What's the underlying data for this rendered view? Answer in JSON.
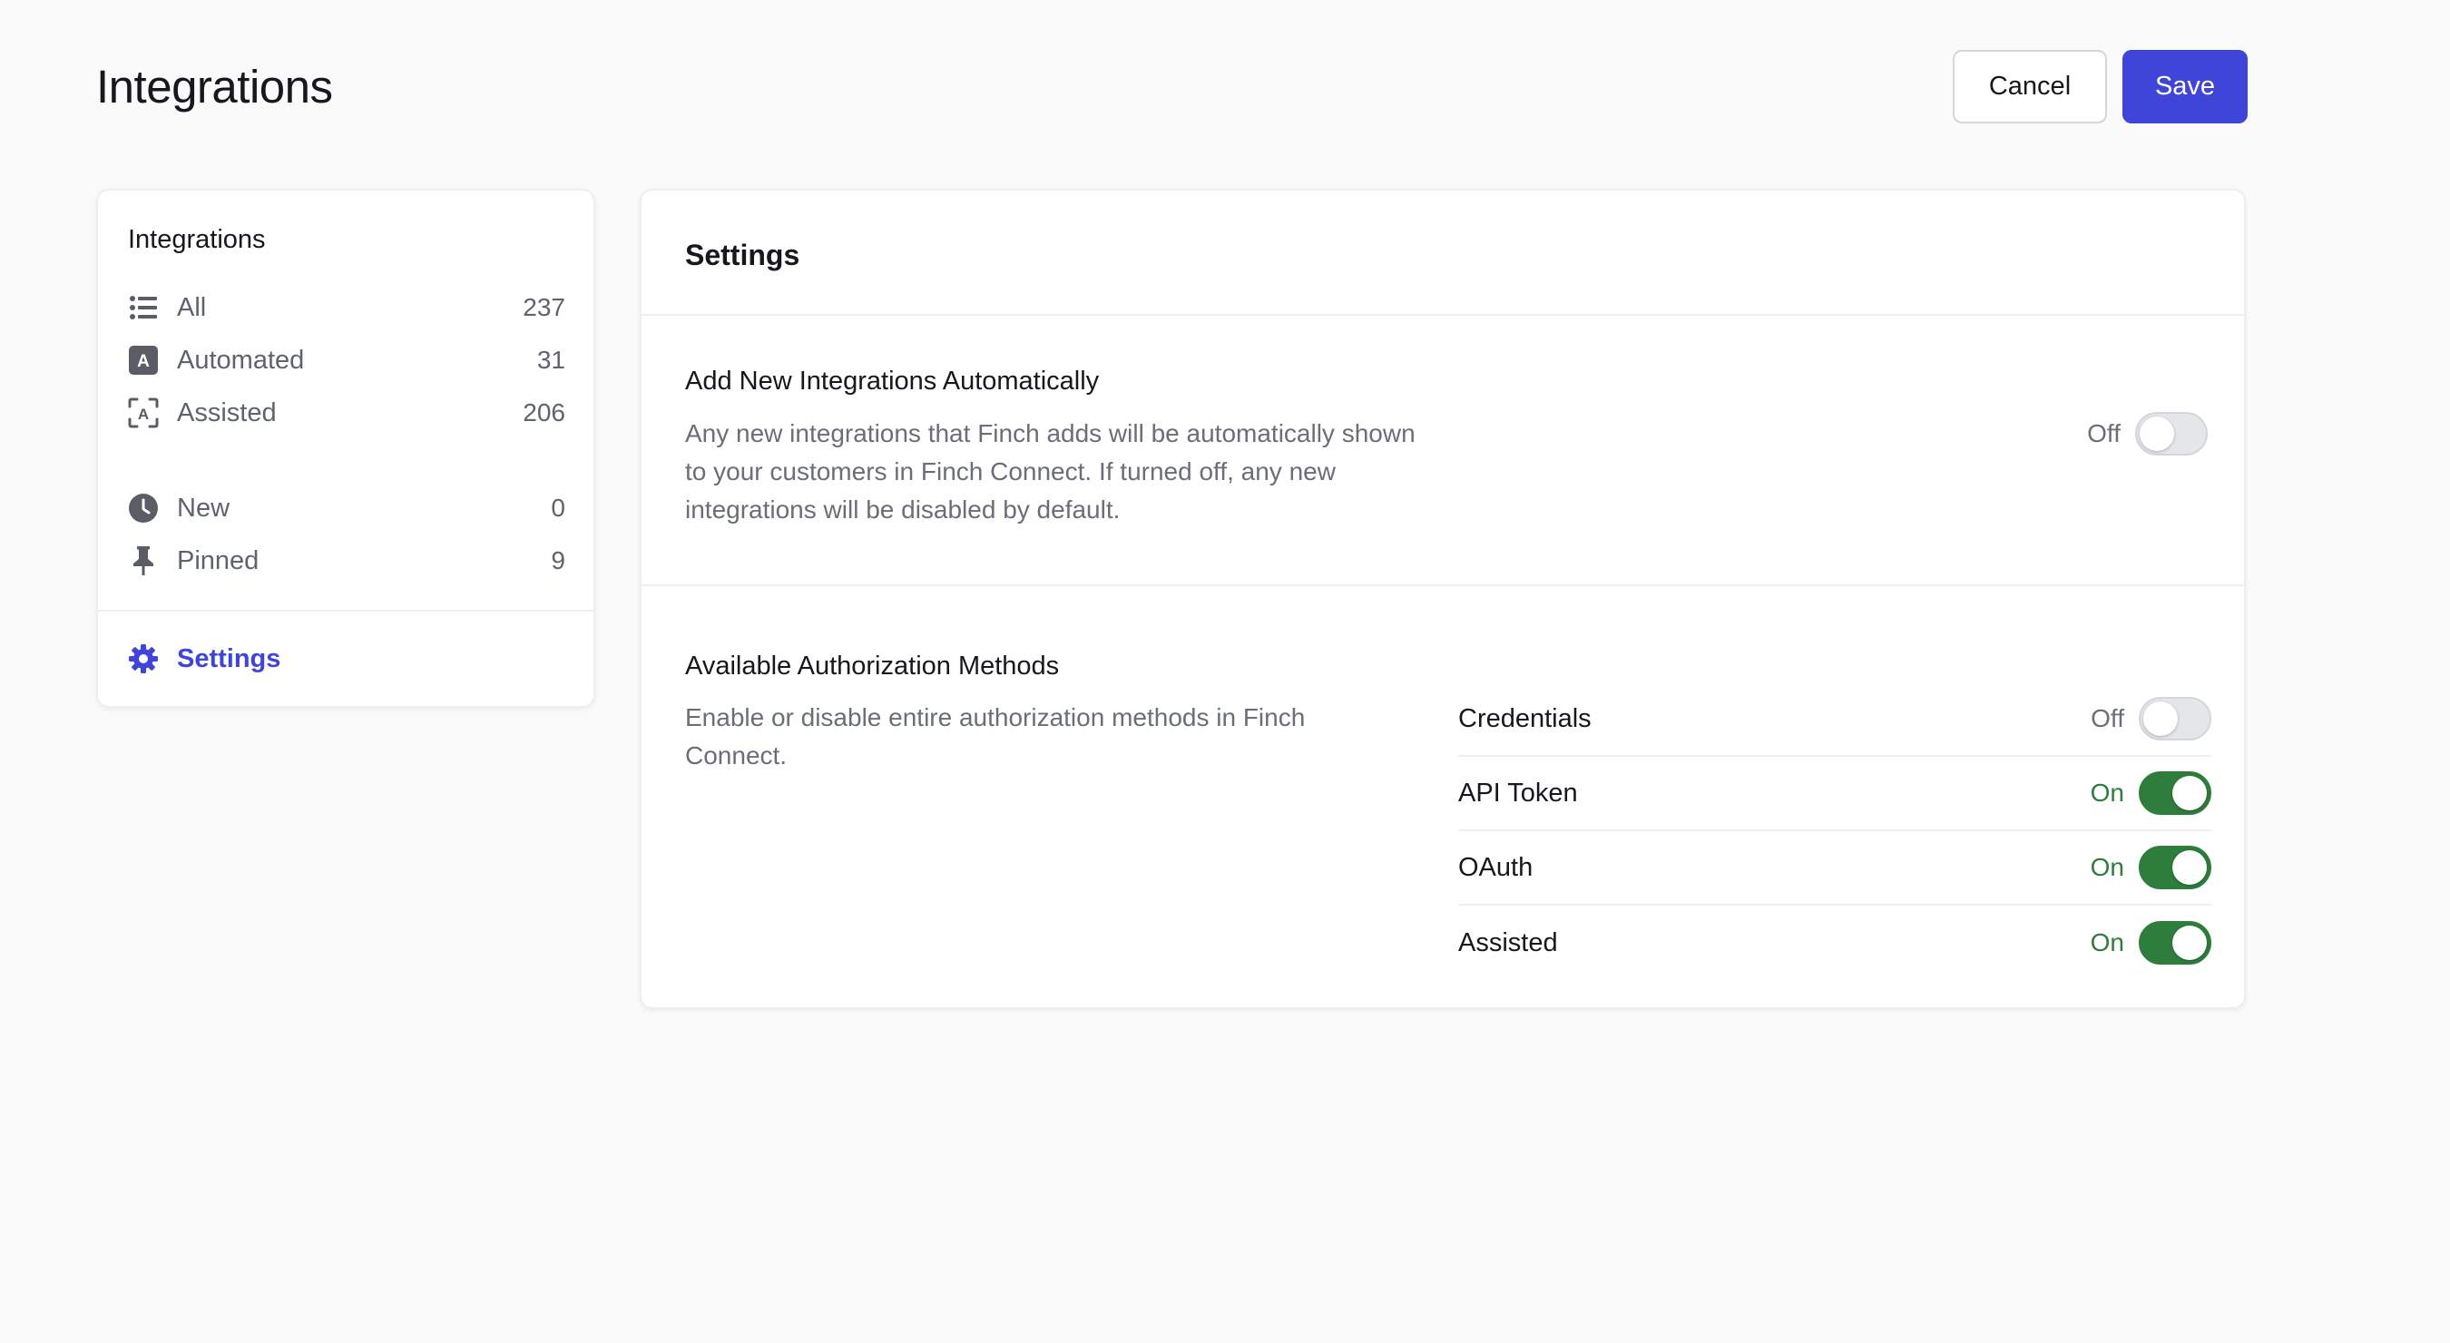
{
  "header": {
    "title": "Integrations",
    "cancel_label": "Cancel",
    "save_label": "Save",
    "accent_color": "#3e45d8"
  },
  "sidebar": {
    "heading": "Integrations",
    "items": [
      {
        "label": "All",
        "count": "237",
        "icon": "list-icon"
      },
      {
        "label": "Automated",
        "count": "31",
        "icon": "automated-icon"
      },
      {
        "label": "Assisted",
        "count": "206",
        "icon": "assisted-icon"
      },
      {
        "label": "New",
        "count": "0",
        "icon": "clock-icon"
      },
      {
        "label": "Pinned",
        "count": "9",
        "icon": "pin-icon"
      }
    ],
    "settings_label": "Settings",
    "settings_icon": "gear-icon"
  },
  "panel": {
    "title": "Settings",
    "auto_add": {
      "title": "Add New Integrations Automatically",
      "description": "Any new integrations that Finch adds will be automatically shown to your customers in Finch Connect. If turned off, any new integrations will be disabled by default.",
      "state": "Off"
    },
    "auth_methods": {
      "title": "Available Authorization Methods",
      "description": "Enable or disable entire authorization methods in Finch Connect.",
      "methods": [
        {
          "label": "Credentials",
          "state": "Off"
        },
        {
          "label": "API Token",
          "state": "On"
        },
        {
          "label": "OAuth",
          "state": "On"
        },
        {
          "label": "Assisted",
          "state": "On"
        }
      ]
    },
    "on_color": "#2e7d3c"
  }
}
